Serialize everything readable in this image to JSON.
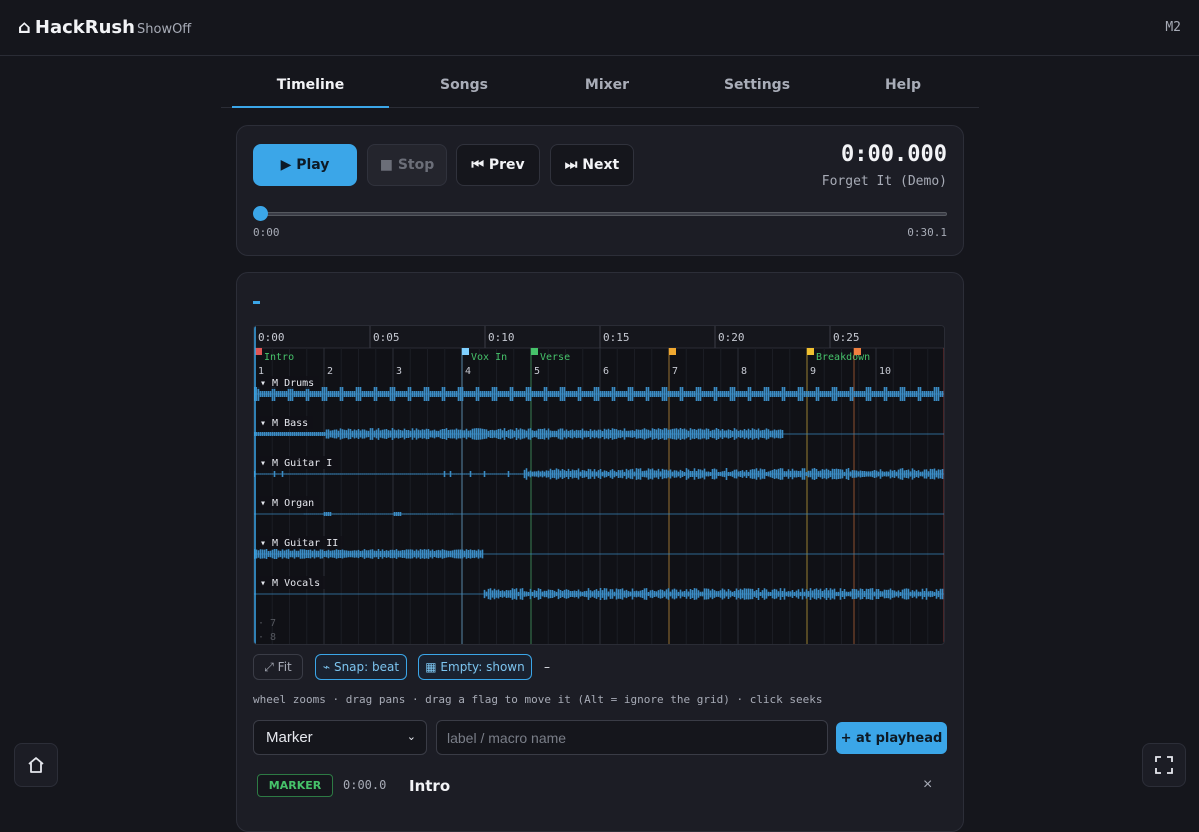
{
  "app": {
    "icon": "home-icon",
    "glyph": "⌂",
    "title": "HackRush",
    "subtitle": "ShowOff",
    "badge": "M2"
  },
  "tabs": [
    {
      "label": "Timeline",
      "active": true
    },
    {
      "label": "Songs"
    },
    {
      "label": "Mixer"
    },
    {
      "label": "Settings"
    },
    {
      "label": "Help"
    }
  ],
  "transport": {
    "play_label": "▶ Play",
    "stop_label": "■ Stop",
    "prev_label": "⏮ Prev",
    "next_label": "⏭ Next",
    "time": "0:00.000",
    "song": "Forget It (Demo)",
    "seek_start": "0:00",
    "seek_end": "0:30.1",
    "progress": 0
  },
  "timeline": {
    "ruler": [
      "0:00",
      "0:05",
      "0:10",
      "0:15",
      "0:20",
      "0:25"
    ],
    "bars": [
      "1",
      "2",
      "3",
      "4",
      "5",
      "6",
      "7",
      "8",
      "9",
      "10"
    ],
    "markers": [
      {
        "label": "Intro",
        "color": "#e05555",
        "textcolor": "#46c26a"
      },
      {
        "label": "Vox In",
        "color": "#7fd0ff",
        "textcolor": "#46c26a"
      },
      {
        "label": "Verse",
        "color": "#46c26a",
        "textcolor": "#46c26a"
      },
      {
        "label": "",
        "color": "#f0a830",
        "textcolor": "#46c26a"
      },
      {
        "label": "Breakdown",
        "color": "#f0c030",
        "textcolor": "#46c26a"
      },
      {
        "label": "",
        "color": "#f08040",
        "textcolor": "#46c26a"
      },
      {
        "label": "",
        "color": "#e05555",
        "textcolor": "#46c26a"
      }
    ],
    "tracks": [
      {
        "name": "Drums",
        "mute": "M",
        "expand": "▾"
      },
      {
        "name": "Bass",
        "mute": "M",
        "expand": "▾"
      },
      {
        "name": "Guitar I",
        "mute": "M",
        "expand": "▾"
      },
      {
        "name": "Organ",
        "mute": "M",
        "expand": "▾"
      },
      {
        "name": "Guitar II",
        "mute": "M",
        "expand": "▾"
      },
      {
        "name": "Vocals",
        "mute": "M",
        "expand": "▾"
      }
    ],
    "empty_lanes": [
      "· 7",
      "· 8"
    ],
    "waveform_color": "#3b8cc4"
  },
  "controls": {
    "fit_label": "⤢ Fit",
    "snap_label": "⌁ Snap: beat",
    "empty_label": "▦ Empty: shown",
    "dash_label": "–"
  },
  "hint": "wheel zooms · drag pans · drag a flag to move it (Alt = ignore the grid) · click seeks",
  "add": {
    "type_value": "Marker",
    "placeholder": "label / macro name",
    "button_label": "+ at playhead"
  },
  "marker_list": [
    {
      "type": "MARKER",
      "time": "0:00.0",
      "name": "Intro",
      "remove": "×"
    }
  ]
}
